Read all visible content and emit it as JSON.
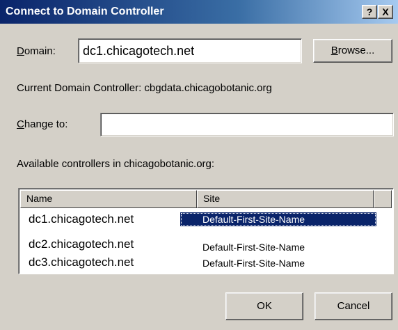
{
  "window": {
    "title": "Connect to Domain Controller",
    "help_glyph": "?",
    "close_glyph": "X"
  },
  "domain": {
    "label_prefix": "",
    "label_accel": "D",
    "label_rest": "omain:",
    "value": "dc1.chicagotech.net",
    "browse_accel": "B",
    "browse_rest": "rowse..."
  },
  "current_dc": {
    "text": "Current Domain Controller: cbgdata.chicagobotanic.org"
  },
  "change_to": {
    "label_accel": "C",
    "label_rest": "hange to:",
    "value": ""
  },
  "available": {
    "label": "Available controllers in chicagobotanic.org:"
  },
  "list": {
    "columns": [
      "Name",
      "Site"
    ],
    "rows": [
      {
        "name": "dc1.chicagotech.net",
        "site": "Default-First-Site-Name",
        "selected": true
      },
      {
        "name": "dc2.chicagotech.net",
        "site": "Default-First-Site-Name",
        "selected": false
      },
      {
        "name": "dc3.chicagotech.net",
        "site": "Default-First-Site-Name",
        "selected": false
      }
    ]
  },
  "buttons": {
    "ok": "OK",
    "cancel": "Cancel"
  },
  "colors": {
    "dialog_bg": "#d4d0c8",
    "title_bar": "#0a246a",
    "selection": "#0a246a"
  }
}
